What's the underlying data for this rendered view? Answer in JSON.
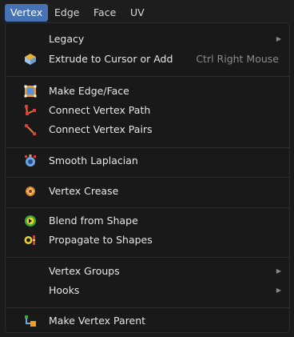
{
  "menubar": {
    "tabs": [
      {
        "label": "Vertex"
      },
      {
        "label": "Edge"
      },
      {
        "label": "Face"
      },
      {
        "label": "UV"
      }
    ]
  },
  "menu": {
    "legacy": {
      "label": "Legacy",
      "icon": "submenu-arrow-icon"
    },
    "extrude": {
      "label": "Extrude to Cursor or Add",
      "shortcut": "Ctrl Right Mouse",
      "icon": "extrude-icon"
    },
    "make_edge_face": {
      "label": "Make Edge/Face",
      "icon": "make-edge-face-icon"
    },
    "connect_path": {
      "label": "Connect Vertex Path",
      "icon": "connect-path-icon"
    },
    "connect_pairs": {
      "label": "Connect Vertex Pairs",
      "icon": "connect-pairs-icon"
    },
    "smooth_laplacian": {
      "label": "Smooth Laplacian",
      "icon": "smooth-laplacian-icon"
    },
    "vertex_crease": {
      "label": "Vertex Crease",
      "icon": "vertex-crease-icon"
    },
    "blend_from_shape": {
      "label": "Blend from Shape",
      "icon": "blend-shape-icon"
    },
    "propagate_to_shapes": {
      "label": "Propagate to Shapes",
      "icon": "propagate-shapes-icon"
    },
    "vertex_groups": {
      "label": "Vertex Groups"
    },
    "hooks": {
      "label": "Hooks"
    },
    "make_vertex_parent": {
      "label": "Make Vertex Parent",
      "icon": "vertex-parent-icon"
    }
  },
  "colors": {
    "accent": "#4772b3",
    "background": "#1a1a1a",
    "text": "#e6e6e6",
    "shortcut_text": "#8a8a8a"
  }
}
